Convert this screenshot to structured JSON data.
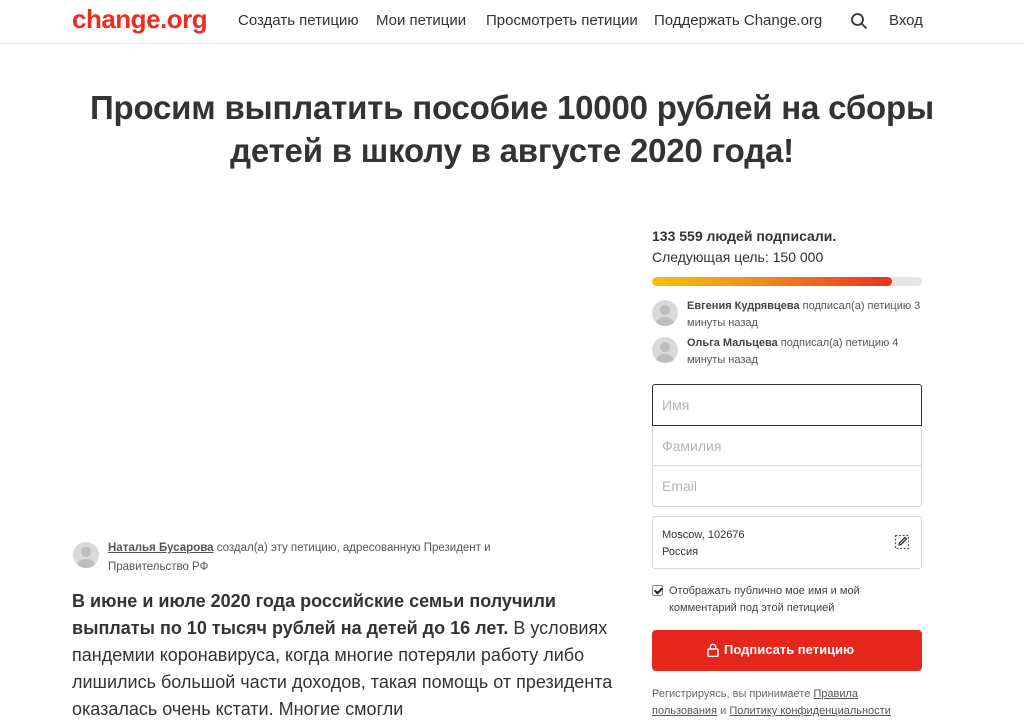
{
  "header": {
    "logo": "change.org",
    "nav": {
      "create": "Создать петицию",
      "my": "Мои петиции",
      "browse": "Просмотреть петиции",
      "support": "Поддержать Change.org"
    },
    "search_icon": "search-icon",
    "login": "Вход"
  },
  "petition": {
    "title": "Просим выплатить пособие 10000 рублей на сборы детей в школу в августе 2020 года!",
    "author": {
      "name": "Наталья Бусарова",
      "text": " создал(а) эту петицию, адресованную Президент и Правительство РФ"
    },
    "body_bold": "В июне и июле 2020 года российские семьи получили выплаты по 10 тысяч рублей на детей до 16 лет.",
    "body_rest": " В условиях пандемии коронавируса, когда многие потеряли работу либо лишились большой части доходов, такая помощь от президента оказалась очень кстати. Многие смогли"
  },
  "sidebar": {
    "signatures": "133 559 людей подписали.",
    "goal": "Следующая цель: 150 000",
    "progress_fraction": 0.89,
    "recent_signers": [
      {
        "name": "Евгения Кудрявцева",
        "action": " подписал(а) петицию 3 минуты назад"
      },
      {
        "name": "Ольга Мальцева",
        "action": " подписал(а) петицию 4 минуты назад"
      }
    ],
    "form": {
      "first_name_placeholder": "Имя",
      "last_name_placeholder": "Фамилия",
      "email_placeholder": "Email",
      "location_line1": "Moscow, 102676",
      "location_line2": "Россия",
      "display_checkbox_label": "Отображать публично мое имя и мой комментарий под этой петицией",
      "display_checked": true,
      "sign_button": "Подписать петицию"
    },
    "terms": {
      "prefix": "Регистрируясь, вы принимаете ",
      "terms_link": "Правила пользования",
      "and": " и ",
      "privacy_link": "Политику конфиденциальности"
    }
  },
  "colors": {
    "brand": "#ec2c22",
    "sign_button": "#e5261c",
    "progress_start": "#f5c20a",
    "progress_end": "#e8321f"
  }
}
